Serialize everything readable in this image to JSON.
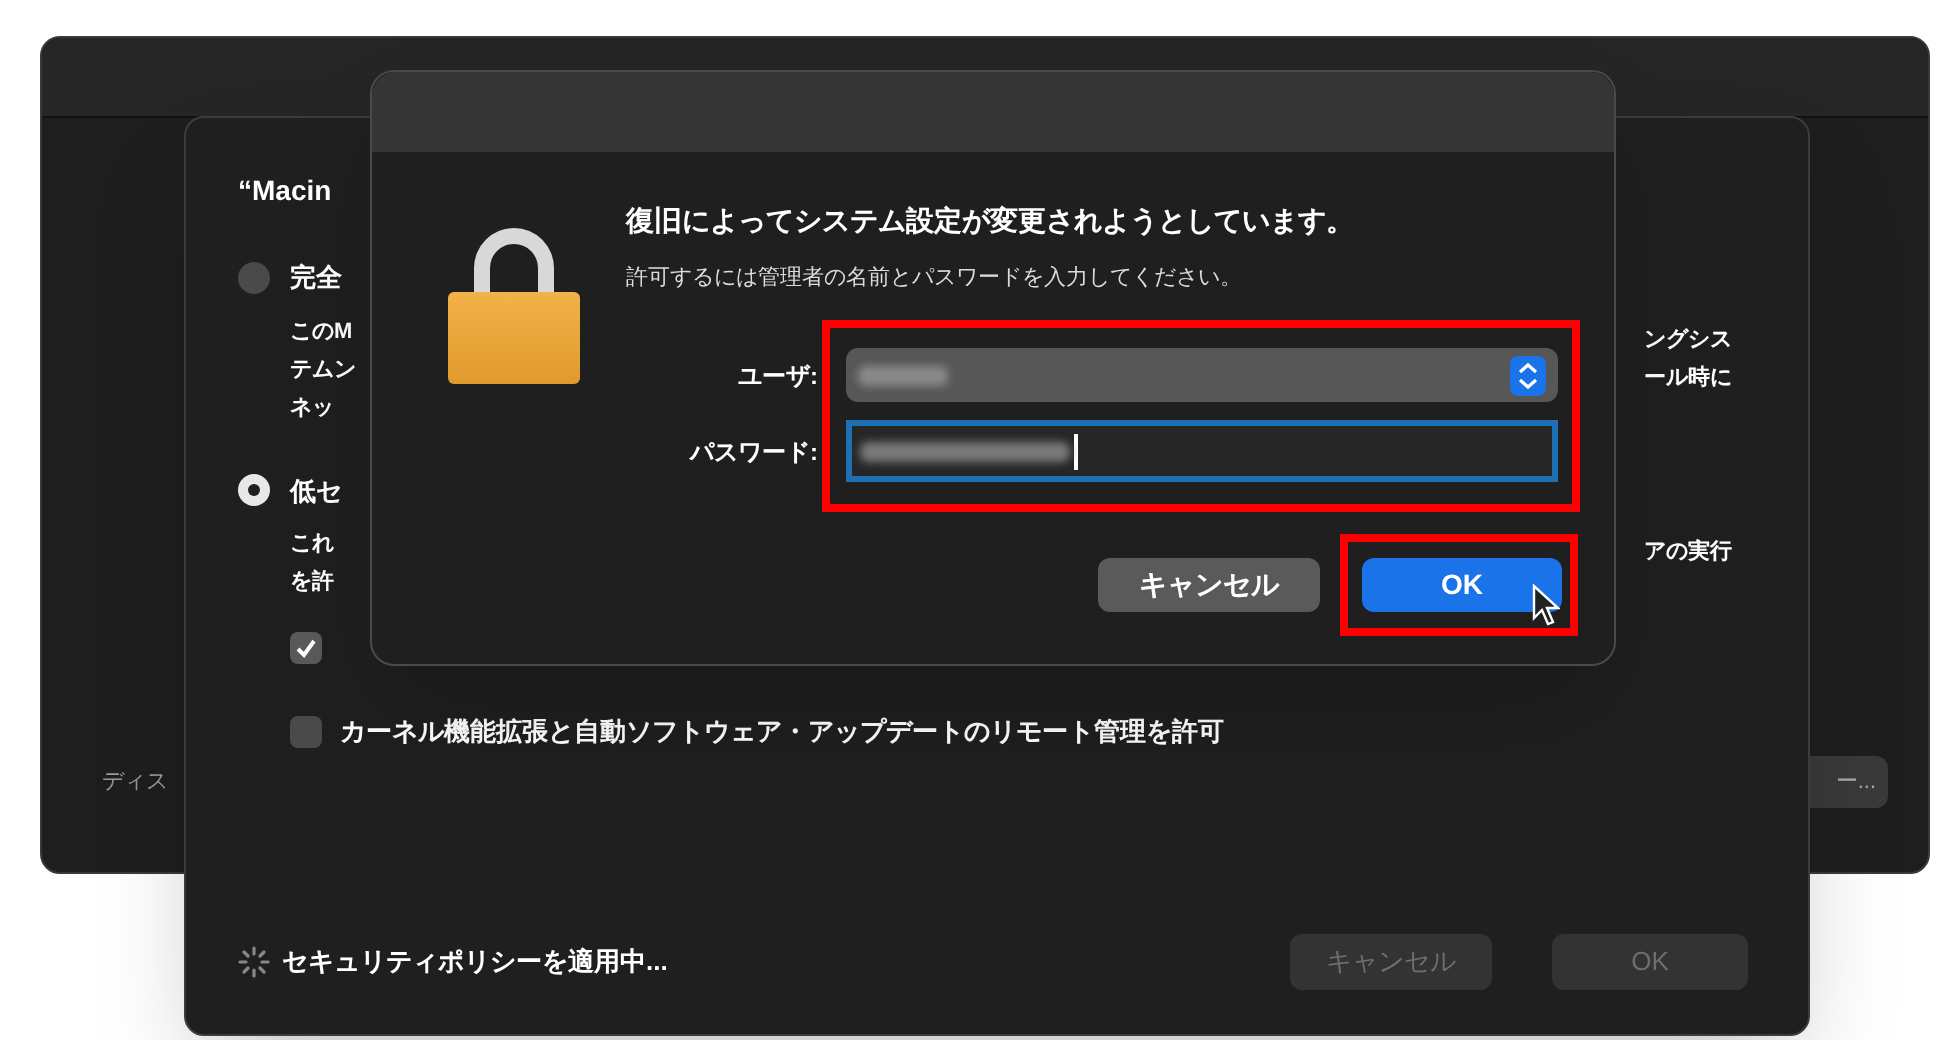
{
  "back_window": {
    "label": "ディス",
    "button": "ー..."
  },
  "sheet": {
    "heading": "“Macin",
    "radios": [
      {
        "label": "完全",
        "selected": false,
        "description": [
          "このM",
          "テムン",
          "ネッ"
        ],
        "note": [
          "ングシス",
          "ール時に"
        ]
      },
      {
        "label": "低セ",
        "selected": true,
        "description": [
          "これ",
          "を許"
        ],
        "note": [
          "アの実行"
        ]
      }
    ],
    "checkboxes": [
      {
        "checked": true
      },
      {
        "label": "カーネル機能拡張と自動ソフトウェア・アップデートのリモート管理を許可",
        "checked": false
      }
    ],
    "status": "セキュリティポリシーを適用中...",
    "buttons": [
      {
        "label": "キャンセル",
        "disabled": true
      },
      {
        "label": "OK",
        "disabled": true
      }
    ]
  },
  "dialog": {
    "title": "復旧によってシステム設定が変更されようとしています。",
    "message": "許可するには管理者の名前とパスワードを入力してください。",
    "user_label": "ユーザ:",
    "password_label": "パスワード:",
    "buttons": [
      {
        "label": "キャンセル",
        "default": false
      },
      {
        "label": "OK",
        "default": true
      }
    ]
  }
}
